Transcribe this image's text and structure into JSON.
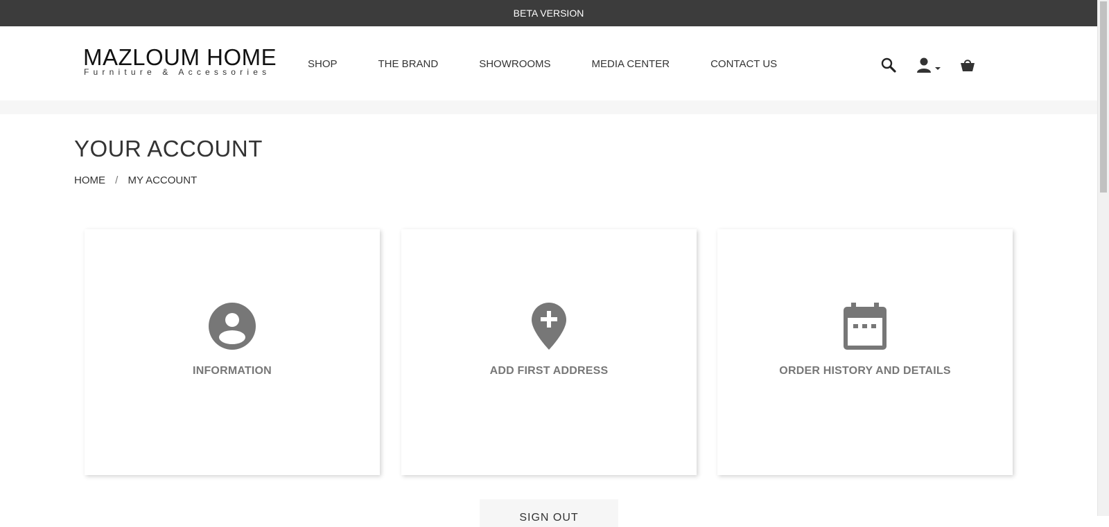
{
  "banner": {
    "text": "BETA VERSION"
  },
  "logo": {
    "title": "MAZLOUM HOME",
    "subtitle": "Furniture & Accessories"
  },
  "nav": {
    "items": [
      {
        "label": "SHOP"
      },
      {
        "label": "THE BRAND"
      },
      {
        "label": "SHOWROOMS"
      },
      {
        "label": "MEDIA CENTER"
      },
      {
        "label": "CONTACT US"
      }
    ]
  },
  "header_icons": [
    "search-icon",
    "user-icon",
    "chevron-down-icon",
    "basket-icon"
  ],
  "page": {
    "title": "YOUR ACCOUNT",
    "breadcrumb": [
      {
        "label": "HOME"
      },
      {
        "label": "MY ACCOUNT"
      }
    ],
    "breadcrumb_separator": "/"
  },
  "cards": [
    {
      "label": "INFORMATION",
      "icon": "account-circle-icon"
    },
    {
      "label": "ADD FIRST ADDRESS",
      "icon": "add-location-icon"
    },
    {
      "label": "ORDER HISTORY AND DETAILS",
      "icon": "calendar-icon"
    }
  ],
  "actions": {
    "signout_label": "SIGN OUT"
  },
  "colors": {
    "banner_bg": "#3c3c3c",
    "icon_grey": "#777777",
    "strip_bg": "#f6f6f6"
  }
}
